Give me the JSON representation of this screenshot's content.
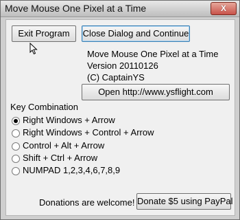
{
  "window": {
    "title": "Move Mouse One Pixel at a Time",
    "close_glyph": "X"
  },
  "buttons": {
    "exit": "Exit Program",
    "close_continue": "Close Dialog and Continue",
    "open_url": "Open http://www.ysflight.com",
    "donate": "Donate $5 using PayPal"
  },
  "info": {
    "app_name": "Move Mouse One Pixel at a Time",
    "version": "Version 20110126",
    "copyright": "(C) CaptainYS"
  },
  "key_combination": {
    "label": "Key Combination",
    "options": [
      {
        "label": "Right Windows + Arrow",
        "checked": true
      },
      {
        "label": "Right Windows + Control + Arrow",
        "checked": false
      },
      {
        "label": "Control + Alt + Arrow",
        "checked": false
      },
      {
        "label": "Shift + Ctrl + Arrow",
        "checked": false
      },
      {
        "label": "NUMPAD 1,2,3,4,6,7,8,9",
        "checked": false
      }
    ]
  },
  "donation_text": "Donations are welcome!",
  "icons": {
    "close": "close-icon",
    "cursor": "mouse-pointer-icon"
  }
}
